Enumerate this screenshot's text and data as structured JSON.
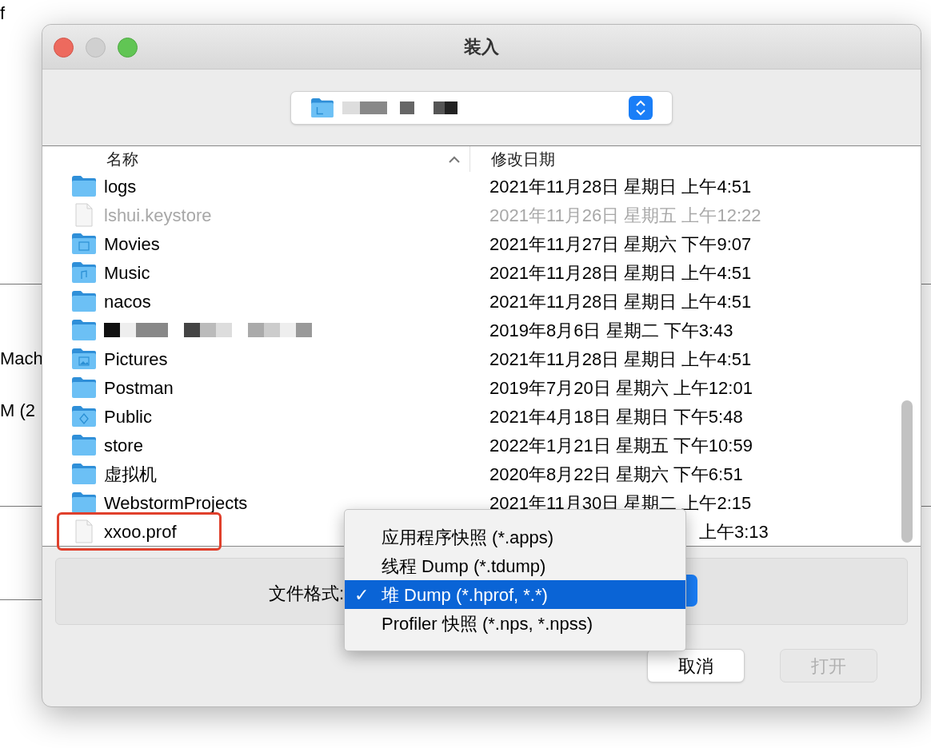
{
  "background_texts": [
    "f",
    "Mach",
    "M (2"
  ],
  "window": {
    "title": "装入"
  },
  "location": {
    "kind": "redacted"
  },
  "columns": [
    {
      "label": "名称",
      "sorted": true
    },
    {
      "label": "修改日期",
      "sorted": false
    }
  ],
  "rows": [
    {
      "name": "logs",
      "kind": "folder",
      "date": "2021年11月28日 星期日 上午4:51",
      "disabled": false
    },
    {
      "name": "lshui.keystore",
      "kind": "file",
      "date": "2021年11月26日 星期五 上午12:22",
      "disabled": true
    },
    {
      "name": "Movies",
      "kind": "movies",
      "date": "2021年11月27日 星期六 下午9:07",
      "disabled": false
    },
    {
      "name": "Music",
      "kind": "music",
      "date": "2021年11月28日 星期日 上午4:51",
      "disabled": false
    },
    {
      "name": "nacos",
      "kind": "folder",
      "date": "2021年11月28日 星期日 上午4:51",
      "disabled": false
    },
    {
      "kind": "folder",
      "redacted": true,
      "date": "2019年8月6日 星期二 下午3:43",
      "disabled": false
    },
    {
      "name": "Pictures",
      "kind": "pictures",
      "date": "2021年11月28日 星期日 上午4:51",
      "disabled": false
    },
    {
      "name": "Postman",
      "kind": "folder",
      "date": "2019年7月20日 星期六 上午12:01",
      "disabled": false
    },
    {
      "name": "Public",
      "kind": "public",
      "date": "2021年4月18日 星期日 下午5:48",
      "disabled": false
    },
    {
      "name": "store",
      "kind": "folder",
      "date": "2022年1月21日 星期五 下午10:59",
      "disabled": false
    },
    {
      "name": "虚拟机",
      "kind": "folder",
      "date": "2020年8月22日 星期六 下午6:51",
      "disabled": false
    },
    {
      "name": "WebstormProjects",
      "kind": "folder",
      "date": "2021年11月30日 星期二 上午2:15",
      "disabled": false
    },
    {
      "name": "xxoo.prof",
      "kind": "file",
      "date": "上午3:13",
      "disabled": false,
      "covered": true,
      "highlighted": true
    }
  ],
  "format": {
    "label": "文件格式:",
    "options": [
      {
        "label": "应用程序快照 (*.apps)",
        "selected": false
      },
      {
        "label": "线程 Dump (*.tdump)",
        "selected": false
      },
      {
        "label": "堆 Dump (*.hprof, *.*)",
        "selected": true,
        "check": "✓"
      },
      {
        "label": "Profiler 快照 (*.nps, *.npss)",
        "selected": false
      }
    ]
  },
  "buttons": [
    {
      "label": "取消",
      "disabled": false
    },
    {
      "label": "打开",
      "disabled": true
    }
  ]
}
